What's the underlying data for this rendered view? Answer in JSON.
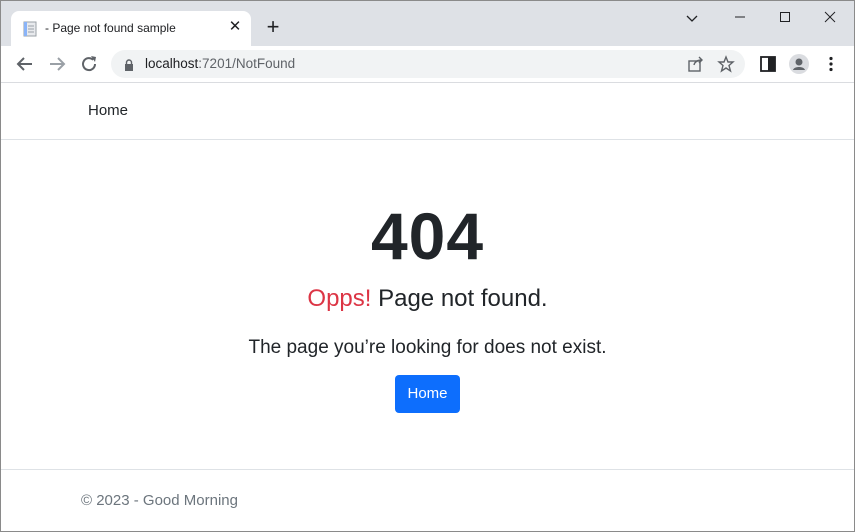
{
  "browser": {
    "tab_title": "- Page not found sample",
    "url_host": "localhost",
    "url_path": ":7201/NotFound"
  },
  "navbar": {
    "home_label": "Home"
  },
  "main": {
    "code": "404",
    "opps": "Opps!",
    "subtitle": " Page not found.",
    "description": "The page you’re looking for does not exist.",
    "button_label": "Home"
  },
  "footer": {
    "text": "© 2023 - Good Morning"
  },
  "colors": {
    "primary": "#0d6efd",
    "danger": "#dc3545",
    "text": "#212529",
    "muted": "#6c757d"
  }
}
